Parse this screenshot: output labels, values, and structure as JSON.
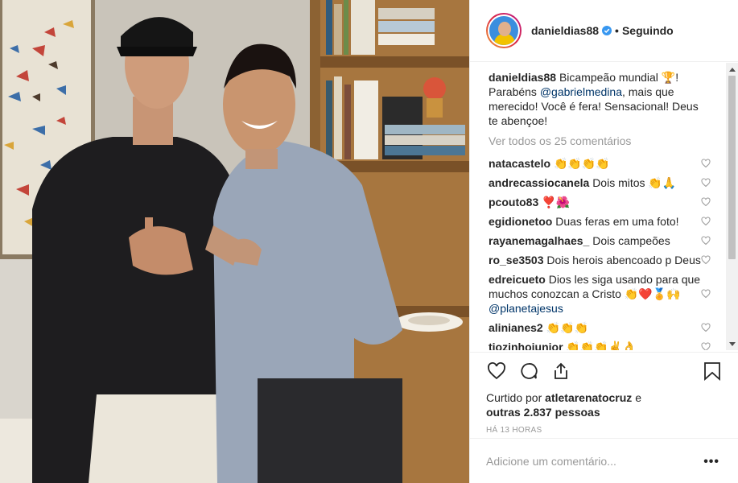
{
  "post": {
    "username": "danieldias88",
    "follow_separator": "•",
    "follow_label": "Seguindo",
    "verified_icon": "verified-badge-icon"
  },
  "caption": {
    "username": "danieldias88",
    "text_before": "Bicampeão mundial 🏆! Parabéns ",
    "mention": "@gabrielmedina",
    "text_after": ", mais que merecido! Você é fera! Sensacional! Deus te abençoe!"
  },
  "view_all": "Ver todos os 25 comentários",
  "comments": [
    {
      "user": "natacastelo",
      "text": "👏👏👏👏"
    },
    {
      "user": "andrecassiocanela",
      "text": "Dois mitos 👏🙏"
    },
    {
      "user": "pcouto83",
      "text": "❣️🌺"
    },
    {
      "user": "egidionetoo",
      "text": "Duas feras em uma foto!"
    },
    {
      "user": "rayanemagalhaes_",
      "text": "Dois campeões"
    },
    {
      "user": "ro_se3503",
      "text": "Dois herois abencoado p Deus"
    },
    {
      "user": "edreicueto",
      "text": "Dios les siga usando para que muchos conozcan a Cristo 👏❤️🏅🙌 ",
      "mention": "@planetajesus"
    },
    {
      "user": "alinianes2",
      "text": "👏👏👏"
    },
    {
      "user": "tiozinhojunior",
      "text": "👏👏👏✌️👌"
    }
  ],
  "actions": {
    "liked_by_prefix": "Curtido por ",
    "liked_by_user": "atletarenatocruz",
    "liked_by_middle": " e",
    "liked_by_others": "outras 2.837 pessoas",
    "timestamp": "HÁ 13 HORAS"
  },
  "add_comment": {
    "placeholder": "Adicione um comentário...",
    "more": "•••"
  },
  "colors": {
    "mention": "#003569",
    "muted": "#999999",
    "verified": "#3897f0"
  }
}
